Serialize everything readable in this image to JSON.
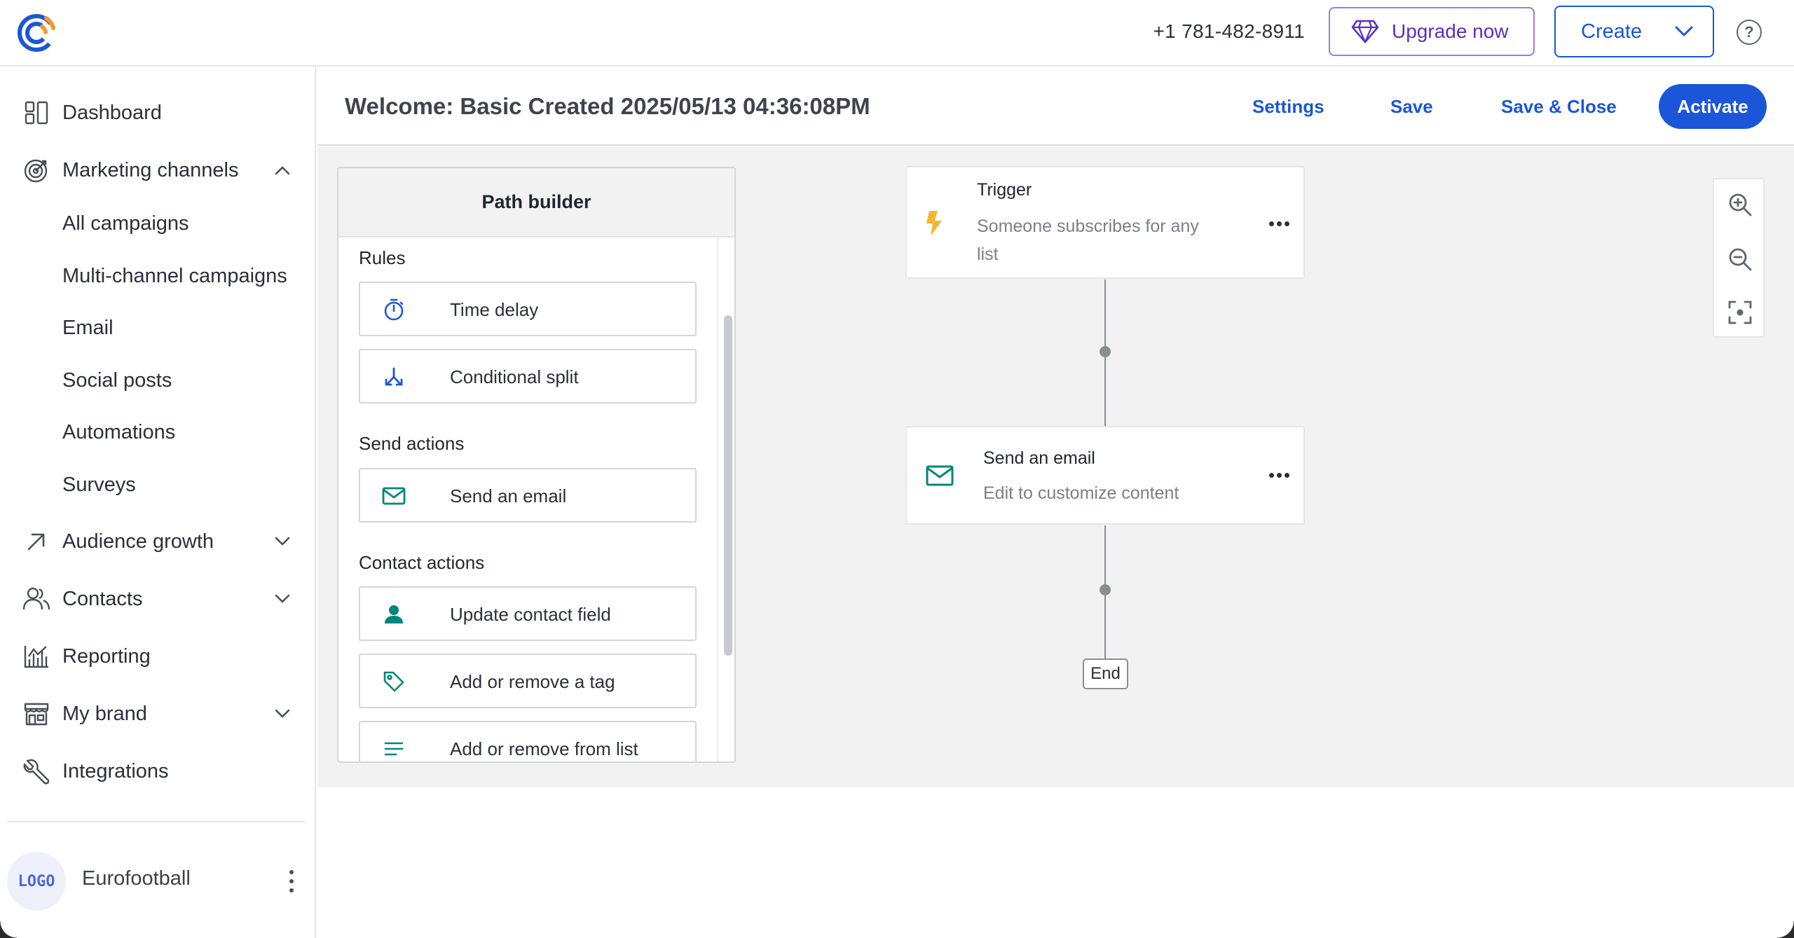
{
  "header": {
    "phone": "+1 781-482-8911",
    "upgrade_label": "Upgrade now",
    "create_label": "Create",
    "help_glyph": "?"
  },
  "sidebar": {
    "items": [
      {
        "label": "Dashboard",
        "icon": "dashboard-icon"
      },
      {
        "label": "Marketing channels",
        "icon": "target-icon",
        "expanded": true
      },
      {
        "label": "Audience growth",
        "icon": "arrow-up-right-icon"
      },
      {
        "label": "Contacts",
        "icon": "contacts-icon"
      },
      {
        "label": "Reporting",
        "icon": "chart-icon"
      },
      {
        "label": "My brand",
        "icon": "store-icon"
      },
      {
        "label": "Integrations",
        "icon": "wrench-icon"
      }
    ],
    "sub_items": [
      "All campaigns",
      "Multi-channel campaigns",
      "Email",
      "Social posts",
      "Automations",
      "Surveys"
    ],
    "account": {
      "logo_text": "LOGO",
      "name": "Eurofootball"
    }
  },
  "toolbar": {
    "title": "Welcome: Basic Created 2025/05/13 04:36:08PM",
    "settings": "Settings",
    "save": "Save",
    "save_close": "Save & Close",
    "activate": "Activate"
  },
  "path_builder": {
    "title": "Path builder",
    "sections": [
      "Rules",
      "Send actions",
      "Contact actions"
    ],
    "items": [
      {
        "label": "Time delay",
        "icon": "stopwatch-icon"
      },
      {
        "label": "Conditional split",
        "icon": "split-icon"
      },
      {
        "label": "Send an email",
        "icon": "envelope-icon"
      },
      {
        "label": "Update contact field",
        "icon": "person-icon"
      },
      {
        "label": "Add or remove a tag",
        "icon": "tag-icon"
      },
      {
        "label": "Add or remove from list",
        "icon": "list-icon"
      }
    ]
  },
  "flow": {
    "trigger": {
      "title": "Trigger",
      "subtitle_line1": "Someone subscribes for any",
      "subtitle_line2": "list",
      "icon": "lightning-icon"
    },
    "email": {
      "title": "Send an email",
      "subtitle": "Edit to customize content",
      "icon": "envelope-icon"
    },
    "end": "End"
  },
  "colors": {
    "brand_blue": "#1b56d8",
    "upgrade_purple": "#5a2fc2",
    "teal_icon": "#00877a",
    "trigger_amber": "#f2b632"
  }
}
